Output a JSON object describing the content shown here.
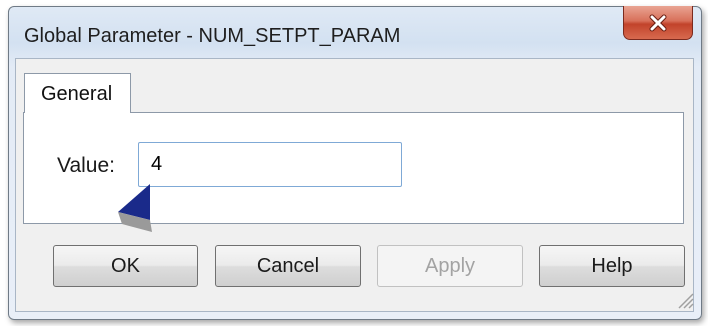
{
  "window": {
    "title": "Global Parameter - NUM_SETPT_PARAM",
    "close_icon": "close-icon"
  },
  "tabs": [
    {
      "label": "General",
      "selected": true
    }
  ],
  "form": {
    "value_label": "Value:",
    "value": "4"
  },
  "buttons": {
    "ok": "OK",
    "cancel": "Cancel",
    "apply": "Apply",
    "help": "Help"
  },
  "annotation": {
    "icon": "pointer-arrow-icon",
    "color": "#1a2a8a"
  },
  "colors": {
    "close_button": "#c8452d",
    "input_border": "#7fa9d6"
  }
}
